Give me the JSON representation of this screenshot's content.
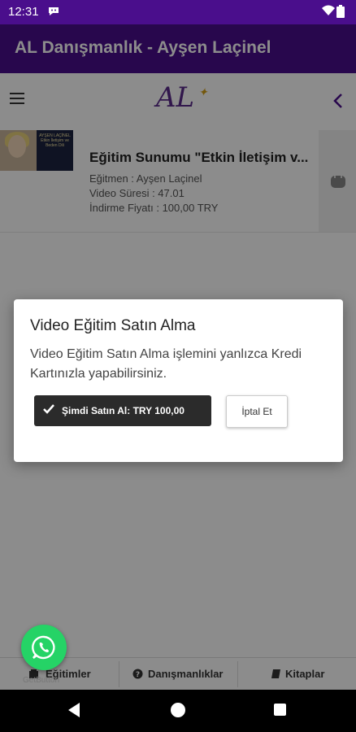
{
  "status_bar": {
    "time": "12:31"
  },
  "app_bar": {
    "title": "AL Danışmanlık - Ayşen Laçinel"
  },
  "toolbar": {
    "logo_text": "AL"
  },
  "training_card": {
    "title": "Eğitim Sunumu \"Etkin İletişim v...",
    "instructor": "Eğitmen : Ayşen Laçinel",
    "duration": "Video Süresi : 47.01",
    "price": "İndirme Fiyatı : 100,00 TRY",
    "thumbnail_book_text": "AYŞEN LAÇİNEL Etkin İletişim ve Beden Dili"
  },
  "dialog": {
    "title": "Video Eğitim Satın Alma",
    "message": "Video Eğitim Satın Alma işlemini yanlızca Kredi Kartınızla yapabilirsiniz.",
    "buy_label": "Şimdi Satın Al: TRY 100,00",
    "cancel_label": "İptal Et"
  },
  "tabs": [
    {
      "label": "Eğitimler",
      "icon": "graduation-icon"
    },
    {
      "label": "Danışmanlıklar",
      "icon": "question-circle-icon"
    },
    {
      "label": "Kitaplar",
      "icon": "book-icon"
    }
  ],
  "whatsapp": {
    "caption": "GetButton"
  },
  "colors": {
    "primary": "#4a0e8c",
    "whatsapp": "#25d366",
    "buy_button": "#2b2b2b"
  }
}
